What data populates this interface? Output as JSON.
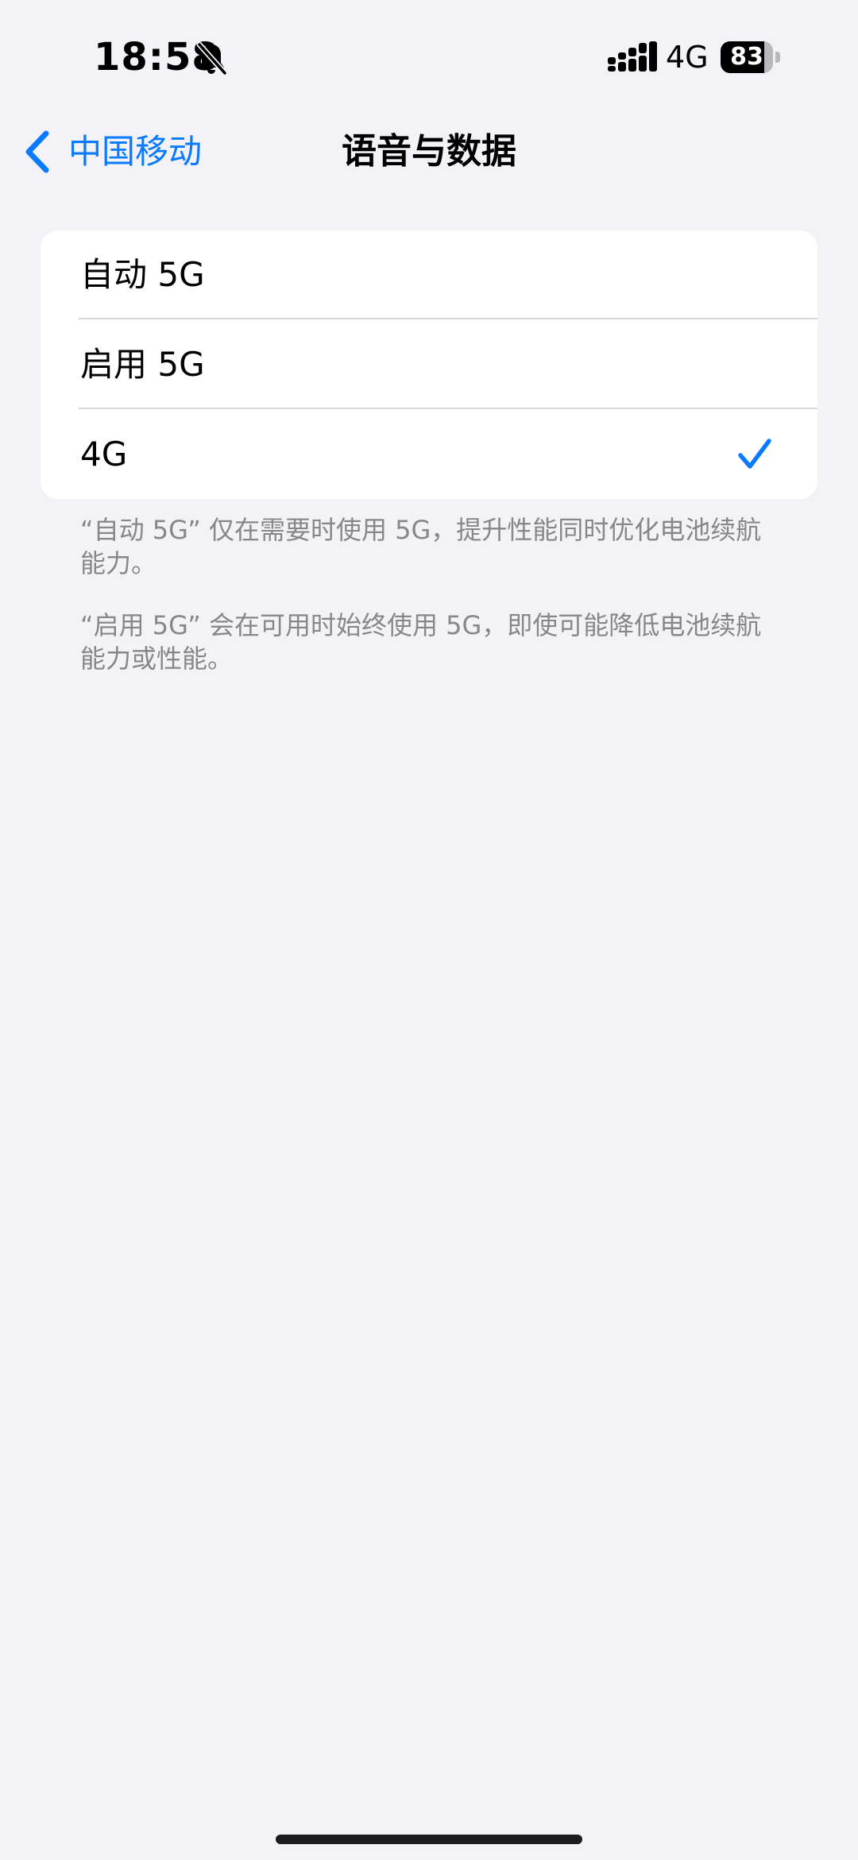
{
  "status_bar": {
    "time": "18:58",
    "network": "4G",
    "battery": "83",
    "battery_level": 0.83,
    "icons": [
      "bell-slash-icon",
      "signal-icon",
      "battery-icon"
    ]
  },
  "nav": {
    "back_label": "中国移动",
    "title": "语音与数据",
    "back_icon": "chevron-left-icon"
  },
  "options": [
    {
      "label": "自动 5G",
      "selected": false
    },
    {
      "label": "启用 5G",
      "selected": false
    },
    {
      "label": "4G",
      "selected": true
    }
  ],
  "footers": [
    "“自动 5G” 仅在需要时使用 5G，提升性能同时优化电池续航能力。",
    "“启用 5G” 会在可用时始终使用 5G，即使可能降低电池续航能力或性能。"
  ],
  "colors": {
    "accent": "#0a7aff",
    "background": "#f2f2f7",
    "card": "#ffffff",
    "secondary_text": "#86868b"
  }
}
